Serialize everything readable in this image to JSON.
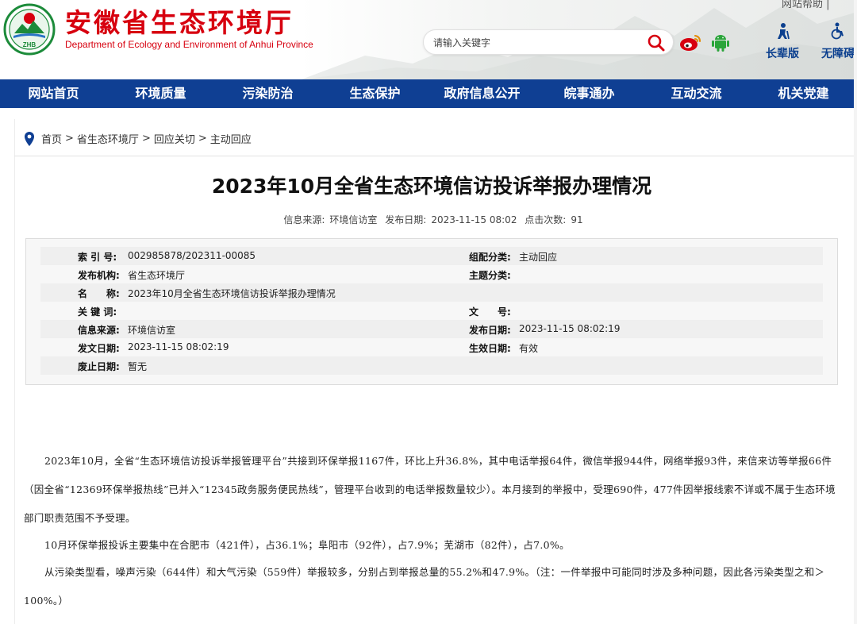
{
  "header": {
    "site_name_cn": "安徽省生态环境厅",
    "site_name_en": "Department of Ecology and Environment of Anhui Province",
    "logo_text": "ZHB",
    "help_link": "网站帮助 |",
    "search": {
      "placeholder": "请输入关键字",
      "value": ""
    },
    "elder_label": "长辈版",
    "accessible_label": "无障碍"
  },
  "nav": {
    "items": [
      {
        "label": "网站首页"
      },
      {
        "label": "环境质量"
      },
      {
        "label": "污染防治"
      },
      {
        "label": "生态保护"
      },
      {
        "label": "政府信息公开"
      },
      {
        "label": "皖事通办"
      },
      {
        "label": "互动交流"
      },
      {
        "label": "机关党建"
      }
    ]
  },
  "breadcrumb": {
    "items": [
      "首页",
      "省生态环境厅",
      "回应关切",
      "主动回应"
    ],
    "separator": ">"
  },
  "article": {
    "title": "2023年10月全省生态环境信访投诉举报办理情况",
    "source_label": "信息来源:",
    "source": "环境信访室",
    "date_label": "发布日期:",
    "date": "2023-11-15 08:02",
    "clicks_label": "点击次数:",
    "clicks": "91"
  },
  "info": {
    "index_no": {
      "label": "索 引 号:",
      "value": "002985878/202311-00085"
    },
    "category": {
      "label": "组配分类:",
      "value": "主动回应"
    },
    "publisher": {
      "label": "发布机构:",
      "value": "省生态环境厅"
    },
    "topic": {
      "label": "主题分类:",
      "value": ""
    },
    "name": {
      "label": "名　　称:",
      "value": "2023年10月全省生态环境信访投诉举报办理情况"
    },
    "keywords": {
      "label": "关 键 词:",
      "value": ""
    },
    "doc_no": {
      "label": "文　　号:",
      "value": ""
    },
    "info_source": {
      "label": "信息来源:",
      "value": "环境信访室"
    },
    "publish_date": {
      "label": "发布日期:",
      "value": "2023-11-15 08:02:19"
    },
    "issue_date": {
      "label": "发文日期:",
      "value": "2023-11-15 08:02:19"
    },
    "effective_date": {
      "label": "生效日期:",
      "value": "有效"
    },
    "expiry_date": {
      "label": "废止日期:",
      "value": "暂无"
    }
  },
  "content": {
    "p1": "2023年10月，全省“生态环境信访投诉举报管理平台”共接到环保举报1167件，环比上升36.8%，其中电话举报64件，微信举报944件，网络举报93件，来信来访等举报66件（因全省“12369环保举报热线”已并入“12345政务服务便民热线”，管理平台收到的电话举报数量较少）。本月接到的举报中，受理690件，477件因举报线索不详或不属于生态环境部门职责范围不予受理。",
    "p2": "10月环保举报投诉主要集中在合肥市（421件），占36.1%；阜阳市（92件），占7.9%；芜湖市（82件），占7.0%。",
    "p3": "从污染类型看，噪声污染（644件）和大气污染（559件）举报较多，分别占到举报总量的55.2%和47.9%。（注：一件举报中可能同时涉及多种问题，因此各污染类型之和＞100%。）"
  },
  "colors": {
    "brand_red": "#d7000f",
    "nav_blue": "#0f3f93",
    "tool_blue": "#0b3f8e"
  }
}
